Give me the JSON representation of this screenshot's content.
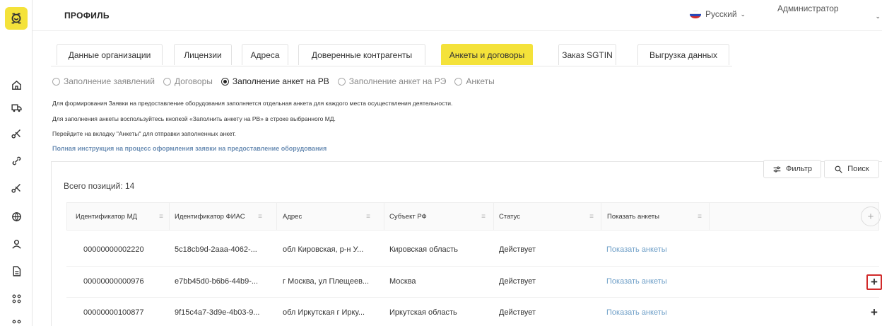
{
  "header": {
    "title": "ПРОФИЛЬ",
    "language": "Русский",
    "user": "Администратор"
  },
  "tabs": [
    {
      "label": "Данные организации",
      "active": false
    },
    {
      "label": "Лицензии",
      "active": false
    },
    {
      "label": "Адреса",
      "active": false
    },
    {
      "label": "Доверенные контрагенты",
      "active": false
    },
    {
      "label": "Анкеты и договоры",
      "active": true
    },
    {
      "label": "Заказ SGTIN",
      "active": false
    },
    {
      "label": "Выгрузка данных",
      "active": false
    }
  ],
  "radios": [
    {
      "label": "Заполнение заявлений",
      "checked": false
    },
    {
      "label": "Договоры",
      "checked": false
    },
    {
      "label": "Заполнение анкет на РВ",
      "checked": true
    },
    {
      "label": "Заполнение анкет на РЭ",
      "checked": false
    },
    {
      "label": "Анкеты",
      "checked": false
    }
  ],
  "info": [
    "Для формирования Заявки на предоставление оборудования заполняется отдельная анкета для каждого места осуществления деятельности.",
    "Для заполнения анкеты воспользуйтесь кнопкой «Заполнить анкету на РВ» в строке выбранного МД.",
    "Перейдите на вкладку \"Анкеты\" для отправки заполненных анкет."
  ],
  "instruction_link": "Полная инструкция на процесс оформления заявки на предоставление оборудования",
  "table": {
    "total": "Всего позиций: 14",
    "filter_label": "Фильтр",
    "search_label": "Поиск",
    "columns": [
      "Идентификатор МД",
      "Идентификатор ФИАС",
      "Адрес",
      "Субъект РФ",
      "Статус",
      "Показать анкеты"
    ],
    "rows": [
      [
        "00000000002220",
        "5c18cb9d-2aaa-4062-...",
        "обл Кировская, р-н У...",
        "Кировская область",
        "Действует",
        "Показать анкеты"
      ],
      [
        "00000000000976",
        "e7bb45d0-b6b6-44b9-...",
        "г Москва, ул Плещеев...",
        "Москва",
        "Действует",
        "Показать анкеты"
      ],
      [
        "00000000100877",
        "9f15c4a7-3d9e-4b03-9...",
        "обл Иркутская г Ирку...",
        "Иркутская область",
        "Действует",
        "Показать анкеты"
      ]
    ]
  },
  "colors": {
    "accent": "#f4e23a",
    "link": "#6d9ec7",
    "highlight": "#d12a2a"
  }
}
